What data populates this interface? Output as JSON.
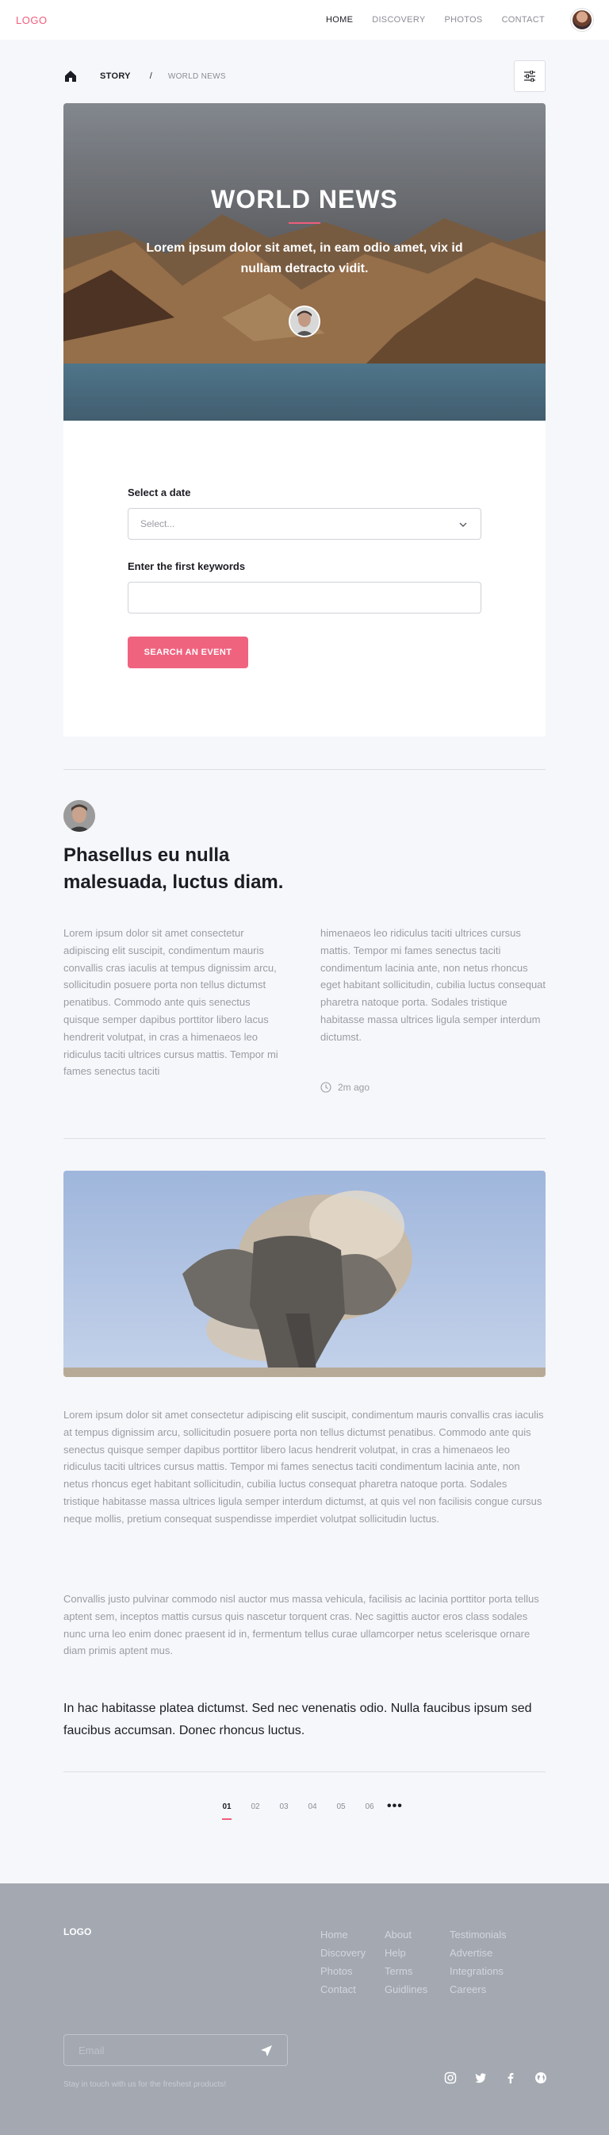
{
  "nav": {
    "logo": "LOGO",
    "links": [
      "HOME",
      "DISCOVERY",
      "PHOTOS",
      "CONTACT"
    ],
    "active": "HOME"
  },
  "breadcrumb": {
    "story": "STORY",
    "separator": "/",
    "current": "WORLD NEWS"
  },
  "hero": {
    "title": "WORLD NEWS",
    "subtitle": "Lorem ipsum dolor sit amet, in eam odio amet, vix id nullam detracto vidit."
  },
  "search": {
    "date_label": "Select a date",
    "date_placeholder": "Select...",
    "keywords_label": "Enter the first keywords",
    "keywords_value": "",
    "button_label": "SEARCH AN EVENT"
  },
  "article": {
    "title": "Phasellus eu nulla malesuada, luctus diam.",
    "col1": "Lorem ipsum dolor sit amet consectetur adipiscing elit suscipit, condimentum mauris convallis cras iaculis at tempus dignissim arcu, sollicitudin posuere porta non tellus dictumst penatibus. Commodo ante quis senectus quisque semper dapibus porttitor libero lacus hendrerit volutpat, in cras a himenaeos leo ridiculus taciti ultrices cursus mattis. Tempor mi fames senectus taciti",
    "col2": "himenaeos leo ridiculus taciti ultrices cursus mattis. Tempor mi fames senectus taciti condimentum lacinia ante, non netus rhoncus eget habitant sollicitudin, cubilia luctus consequat pharetra natoque porta. Sodales tristique habitasse massa ultrices ligula semper interdum dictumst.",
    "time": "2m ago",
    "para1": "Lorem ipsum dolor sit amet consectetur adipiscing elit suscipit, condimentum mauris convallis cras iaculis at tempus dignissim arcu, sollicitudin posuere porta non tellus dictumst penatibus. Commodo ante quis senectus quisque semper dapibus porttitor libero lacus hendrerit volutpat, in cras a himenaeos leo ridiculus taciti ultrices cursus mattis. Tempor mi fames senectus taciti condimentum lacinia ante, non netus rhoncus eget habitant sollicitudin, cubilia luctus consequat pharetra natoque porta. Sodales tristique habitasse massa ultrices ligula semper interdum dictumst, at quis vel non facilisis congue cursus neque mollis, pretium consequat suspendisse imperdiet volutpat sollicitudin luctus.",
    "para2": "Convallis justo pulvinar commodo nisl auctor mus massa vehicula, facilisis ac lacinia porttitor porta tellus aptent sem, inceptos mattis cursus quis nascetur torquent cras. Nec sagittis auctor eros class sodales nunc urna leo enim donec praesent id in, fermentum tellus curae ullamcorper netus scelerisque ornare diam primis aptent mus.",
    "quote": "In hac habitasse platea dictumst. Sed nec venenatis odio. Nulla faucibus ipsum sed faucibus accumsan. Donec rhoncus luctus."
  },
  "pagination": {
    "pages": [
      "01",
      "02",
      "03",
      "04",
      "05",
      "06"
    ],
    "active": "01"
  },
  "footer": {
    "logo": "LOGO",
    "col1": [
      "Home",
      "Discovery",
      "Photos",
      "Contact"
    ],
    "col2": [
      "About",
      "Help",
      "Terms",
      "Guidlines"
    ],
    "col3": [
      "Testimonials",
      "Advertise",
      "Integrations",
      "Careers"
    ],
    "email_placeholder": "Email",
    "note": "Stay in touch with us for the freshest products!",
    "socials": [
      "instagram-icon",
      "twitter-icon",
      "facebook-icon",
      "globe-icon"
    ]
  },
  "colors": {
    "accent": "#ef5d7c",
    "footer_bg": "#a3a8b1",
    "page_bg": "#f6f7fa"
  }
}
